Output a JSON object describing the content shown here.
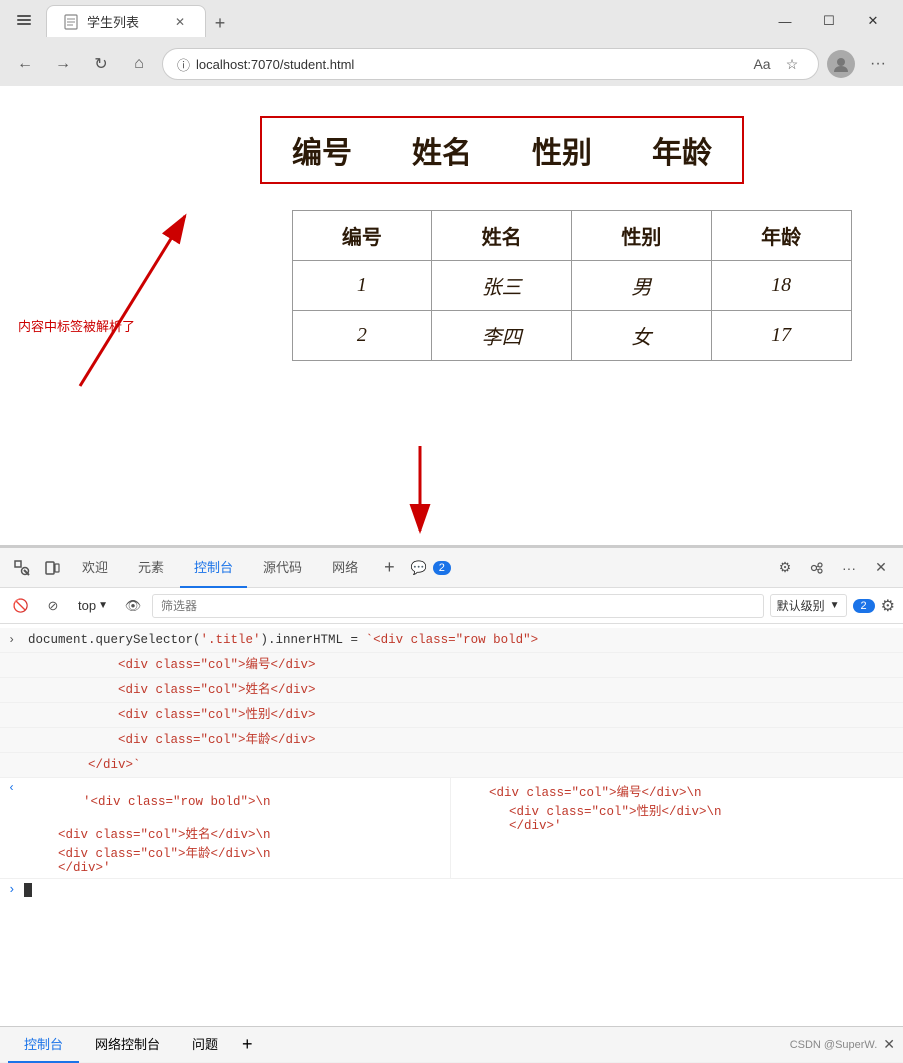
{
  "browser": {
    "title": "学生列表",
    "url": "localhost:7070/student.html",
    "new_tab_label": "+",
    "close_label": "✕",
    "minimize_label": "—",
    "maximize_label": "☐",
    "back_label": "←",
    "forward_label": "→",
    "home_label": "⌂",
    "info_label": "ⓘ",
    "more_label": "···"
  },
  "page": {
    "title_columns": [
      "编号",
      "姓名",
      "性别",
      "年龄"
    ],
    "table_headers": [
      "编号",
      "姓名",
      "性别",
      "年龄"
    ],
    "table_rows": [
      [
        "1",
        "张三",
        "男",
        "18"
      ],
      [
        "2",
        "李四",
        "女",
        "17"
      ]
    ],
    "annotation": "内容中标签被解析了"
  },
  "devtools": {
    "tabs": [
      "欢迎",
      "元素",
      "控制台",
      "源代码",
      "网络"
    ],
    "active_tab": "控制台",
    "badge_count": "2",
    "top_label": "top",
    "filter_placeholder": "筛选器",
    "log_level": "默认级别",
    "settings_label": "⚙",
    "console_lines": [
      {
        "type": "input",
        "arrow": ">",
        "text": "document.querySelector('.title').innerHTML = `<div class=\"row bold\">"
      },
      {
        "type": "input",
        "indent": true,
        "text": "            <div class=\"col\">编号</div>"
      },
      {
        "type": "input",
        "indent": true,
        "text": "            <div class=\"col\">姓名</div>"
      },
      {
        "type": "input",
        "indent": true,
        "text": "            <div class=\"col\">性别</div>"
      },
      {
        "type": "input",
        "indent": true,
        "text": "            <div class=\"col\">年龄</div>"
      },
      {
        "type": "input",
        "indent": true,
        "text": "        </div>`"
      },
      {
        "type": "output",
        "arrow": "<",
        "col1": "'<div class=\"row bold\">\\n    <div class=\"col\">编号</div>\\n",
        "col2": "    <div class=\"col\">性别</div>\\n",
        "line2col1": "    <div class=\"col\">姓名</div>\\n",
        "line2col2": "    <div class=\"col\">年龄</div>\\n",
        "line3": "    </div>'"
      }
    ],
    "bottom_tabs": [
      "控制台",
      "网络控制台",
      "问题"
    ],
    "active_bottom_tab": "控制台",
    "watermark": "CSDN @SuperW."
  }
}
